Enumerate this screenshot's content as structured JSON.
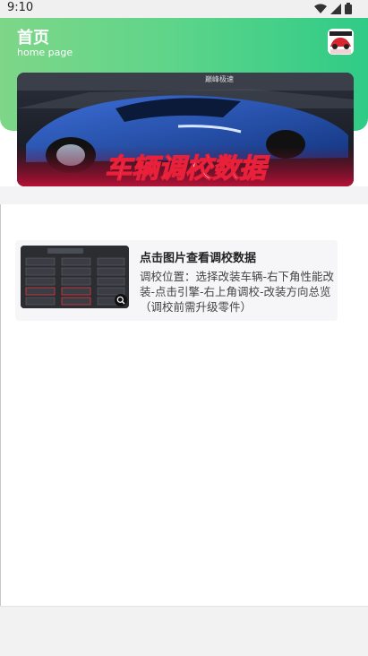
{
  "status_bar": {
    "time": "9:10"
  },
  "header": {
    "title": "首页",
    "subtitle": "home page"
  },
  "banner": {
    "caption": "车辆调校数据"
  },
  "card": {
    "title": "点击图片查看调校数据",
    "description": "调校位置：选择改装车辆-右下角性能改装-点击引擎-右上角调校-改装方向总览（调校前需升级零件）"
  },
  "colors": {
    "header_start": "#7ed688",
    "header_end": "#2fcb86",
    "banner_text_red": "#e8203a"
  }
}
